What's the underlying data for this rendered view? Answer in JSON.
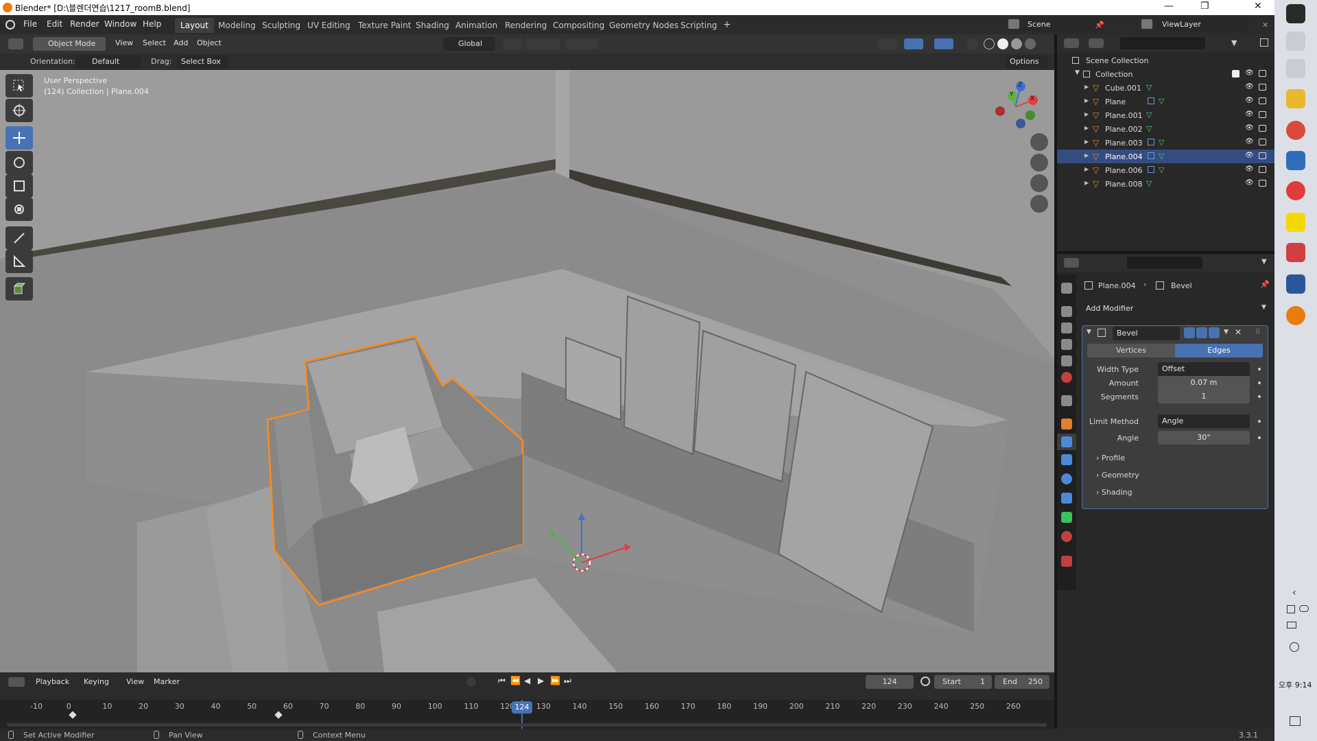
{
  "window": {
    "title": "Blender* [D:\\블렌더연습\\1217_roomB.blend]"
  },
  "menus": [
    "File",
    "Edit",
    "Render",
    "Window",
    "Help"
  ],
  "workspaces": [
    "Layout",
    "Modeling",
    "Sculpting",
    "UV Editing",
    "Texture Paint",
    "Shading",
    "Animation",
    "Rendering",
    "Compositing",
    "Geometry Nodes",
    "Scripting"
  ],
  "active_workspace": "Layout",
  "scene": {
    "label": "Scene",
    "view_layer": "ViewLayer"
  },
  "viewport_header": {
    "mode": "Object Mode",
    "menus": [
      "View",
      "Select",
      "Add",
      "Object"
    ],
    "transform": "Global"
  },
  "tool_header": {
    "orientation_label": "Orientation:",
    "orientation_value": "Default",
    "drag_label": "Drag:",
    "drag_value": "Select Box",
    "options": "Options"
  },
  "viewport": {
    "perspective": "User Perspective",
    "collection_info": "(124) Collection | Plane.004",
    "gizmo": {
      "x": "X",
      "y": "Y",
      "z": "Z"
    }
  },
  "outliner": {
    "root": "Scene Collection",
    "collection": "Collection",
    "items": [
      {
        "name": "Cube.001",
        "modifier": false,
        "selected": false
      },
      {
        "name": "Plane",
        "modifier": true,
        "selected": false
      },
      {
        "name": "Plane.001",
        "modifier": false,
        "selected": false
      },
      {
        "name": "Plane.002",
        "modifier": false,
        "selected": false
      },
      {
        "name": "Plane.003",
        "modifier": true,
        "selected": false
      },
      {
        "name": "Plane.004",
        "modifier": true,
        "selected": true
      },
      {
        "name": "Plane.006",
        "modifier": true,
        "selected": false
      },
      {
        "name": "Plane.008",
        "modifier": false,
        "selected": false
      }
    ]
  },
  "properties": {
    "breadcrumb_object": "Plane.004",
    "breadcrumb_modifier": "Bevel",
    "add_modifier": "Add Modifier",
    "modifier": {
      "name": "Bevel",
      "mode_tabs": [
        "Vertices",
        "Edges"
      ],
      "active_mode": "Edges",
      "width_type_label": "Width Type",
      "width_type": "Offset",
      "amount_label": "Amount",
      "amount": "0.07 m",
      "segments_label": "Segments",
      "segments": "1",
      "limit_method_label": "Limit Method",
      "limit_method": "Angle",
      "angle_label": "Angle",
      "angle": "30°",
      "subpanels": [
        "Profile",
        "Geometry",
        "Shading"
      ]
    }
  },
  "timeline": {
    "menus": [
      "Playback",
      "Keying",
      "View",
      "Marker"
    ],
    "current_frame": "124",
    "start_label": "Start",
    "start": "1",
    "end_label": "End",
    "end": "250",
    "ruler": [
      "-10",
      "0",
      "10",
      "20",
      "30",
      "40",
      "50",
      "60",
      "70",
      "80",
      "90",
      "100",
      "110",
      "120",
      "130",
      "140",
      "150",
      "160",
      "170",
      "180",
      "190",
      "200",
      "210",
      "220",
      "230",
      "240",
      "250",
      "260"
    ]
  },
  "status_bar": {
    "left": "Set Active Modifier",
    "middle": "Pan View",
    "right": "Context Menu",
    "version": "3.3.1"
  },
  "taskbar": {
    "clock": "오후 9:14"
  }
}
